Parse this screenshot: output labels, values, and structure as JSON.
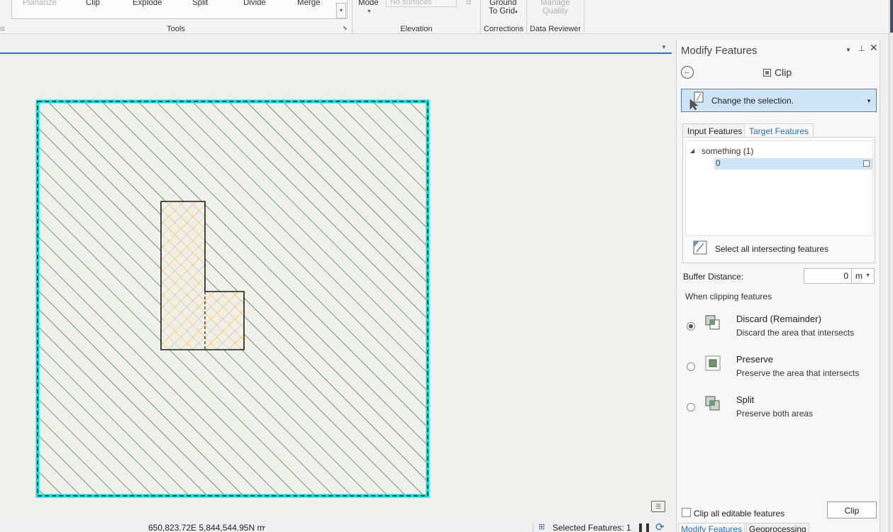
{
  "ribbon": {
    "tools": {
      "buttons": [
        {
          "label": "Planarize",
          "enabled": false
        },
        {
          "label": "Clip",
          "enabled": true
        },
        {
          "label": "Explode",
          "enabled": true
        },
        {
          "label": "Split",
          "enabled": true
        },
        {
          "label": "Divide",
          "enabled": true
        },
        {
          "label": "Merge",
          "enabled": true
        }
      ],
      "group_label": "Tools"
    },
    "elevation": {
      "mode_label": "Mode",
      "surface_placeholder": "No surfaces",
      "group_label": "Elevation"
    },
    "corrections": {
      "button_line1": "Ground",
      "button_line2": "To Grid",
      "group_label": "Corrections"
    },
    "data_reviewer": {
      "button_line1": "Manage",
      "button_line2": "Quality",
      "group_label": "Data Reviewer"
    }
  },
  "status_bar": {
    "coordinates": "650,823.72E 5,844,544.95N m",
    "selected_features": "Selected Features: 1"
  },
  "pane": {
    "title": "Modify Features",
    "tool_title": "Clip",
    "selection_dropdown": "Change the selection.",
    "tabs": [
      "Input Features",
      "Target Features"
    ],
    "active_tab": "Target Features",
    "tree": {
      "layer": "something (1)",
      "feature": "0"
    },
    "select_all_label": "Select all intersecting features",
    "buffer": {
      "label": "Buffer Distance:",
      "value": "0",
      "unit": "m"
    },
    "when_clipping_label": "When clipping features",
    "options": [
      {
        "title": "Discard (Remainder)",
        "desc": "Discard the area that intersects",
        "selected": true
      },
      {
        "title": "Preserve",
        "desc": "Preserve the area that intersects",
        "selected": false
      },
      {
        "title": "Split",
        "desc": "Preserve both areas",
        "selected": false
      }
    ],
    "clip_all_label": "Clip all editable features",
    "clip_all_checked": false,
    "clip_button": "Clip",
    "bottom_tabs": [
      "Modify Features",
      "Geoprocessing"
    ]
  },
  "colors": {
    "accent": "#2a72c9",
    "selection_outline": "#00e5e5",
    "target_hatch": "#2e6b2e",
    "input_hatch": "#f2b233"
  },
  "icons": {
    "back": "back-arrow-icon",
    "pin": "pin-icon",
    "close": "close-icon",
    "options": "chevron-down-icon"
  }
}
